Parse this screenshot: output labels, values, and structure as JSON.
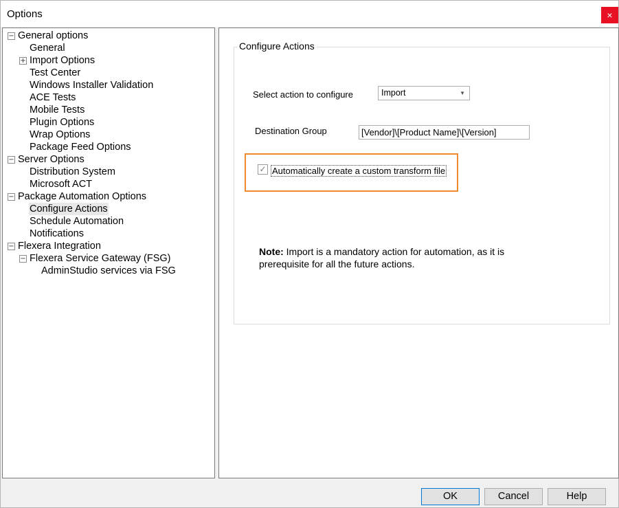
{
  "window": {
    "title": "Options",
    "close_glyph": "×"
  },
  "tree": {
    "items": [
      {
        "label": "General options",
        "toggle": "−"
      },
      {
        "label": "General"
      },
      {
        "label": "Import Options",
        "toggle": "+"
      },
      {
        "label": "Test Center"
      },
      {
        "label": "Windows Installer Validation"
      },
      {
        "label": "ACE Tests"
      },
      {
        "label": "Mobile Tests"
      },
      {
        "label": "Plugin Options"
      },
      {
        "label": "Wrap Options"
      },
      {
        "label": "Package Feed Options"
      },
      {
        "label": "Server Options",
        "toggle": "−"
      },
      {
        "label": "Distribution System"
      },
      {
        "label": "Microsoft ACT"
      },
      {
        "label": "Package Automation Options",
        "toggle": "−"
      },
      {
        "label": "Configure Actions",
        "selected": true
      },
      {
        "label": "Schedule Automation"
      },
      {
        "label": "Notifications"
      },
      {
        "label": "Flexera Integration",
        "toggle": "−"
      },
      {
        "label": "Flexera Service Gateway (FSG)",
        "toggle": "−"
      },
      {
        "label": "AdminStudio services via FSG"
      }
    ]
  },
  "content": {
    "group_title": "Configure Actions",
    "select_action_label": "Select action to configure",
    "select_action_value": "Import",
    "destination_group_label": "Destination Group",
    "destination_group_value": "[Vendor]\\[Product Name]\\[Version]",
    "checkbox_label": "Automatically create a custom transform file",
    "checkbox_checked": true,
    "check_glyph": "✓",
    "note_bold": "Note:",
    "note_text": " Import is a mandatory action for automation, as it is prerequisite for all the future actions."
  },
  "buttons": {
    "ok": "OK",
    "cancel": "Cancel",
    "help": "Help"
  },
  "colors": {
    "highlight": "#f0882c",
    "close": "#e81123"
  }
}
